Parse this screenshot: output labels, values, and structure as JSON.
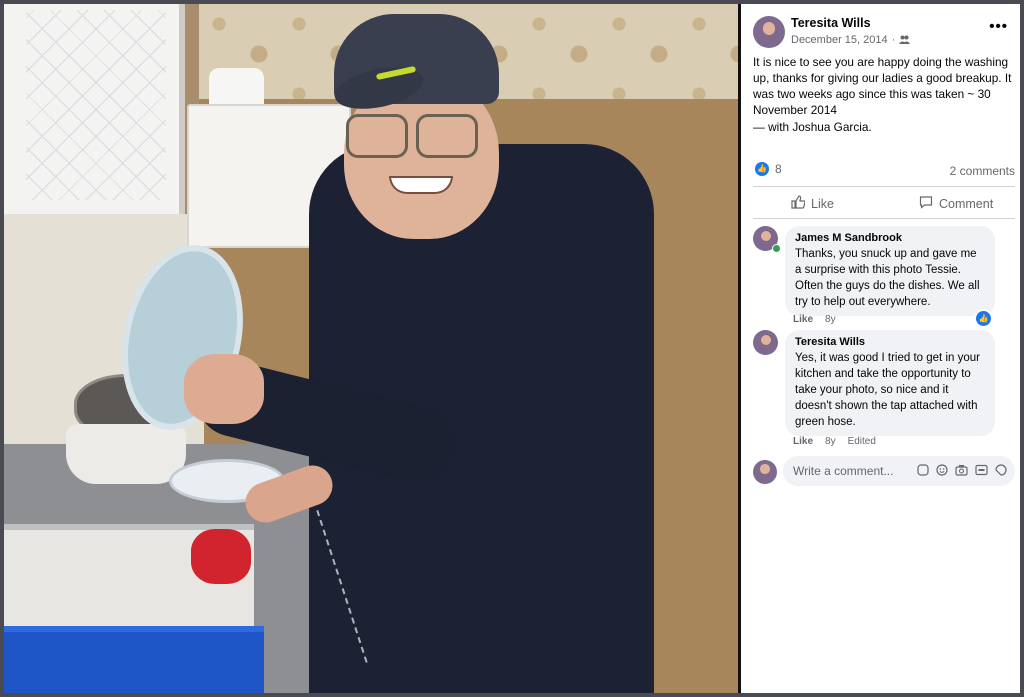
{
  "post": {
    "author": "Teresita Wills",
    "date": "December 15, 2014",
    "privacy_icon": "friends-icon",
    "more_label": "•••",
    "text": "It is nice to see you are happy doing the washing up, thanks for giving our ladies a good breakup. It was two weeks ago since this was taken ~ 30 November 2014",
    "with_prefix": "— with",
    "with_name": "Joshua Garcia",
    "with_suffix": ".",
    "reaction_count": "8",
    "comments_count": "2 comments",
    "like_label": "Like",
    "comment_label": "Comment"
  },
  "comments": [
    {
      "name": "James M Sandbrook",
      "text": "Thanks, you snuck up and gave me a surprise with this photo Tessie. Often the guys do the dishes. We all try to help out everywhere.",
      "like": "Like",
      "age": "8y",
      "edited": ""
    },
    {
      "name": "Teresita Wills",
      "text": "Yes, it was good I tried to get in your kitchen and take the opportunity to take your photo, so nice and it doesn't shown the tap attached with green hose.",
      "like": "Like",
      "age": "8y",
      "edited": "Edited"
    }
  ],
  "composer": {
    "placeholder": "Write a comment...",
    "icons": [
      "sticker-icon",
      "emoji-icon",
      "camera-icon",
      "gif-icon",
      "sticker-face-icon"
    ]
  },
  "colors": {
    "accent": "#1877f2",
    "text": "#050505",
    "muted": "#65676b",
    "bubble": "#f0f2f5"
  }
}
